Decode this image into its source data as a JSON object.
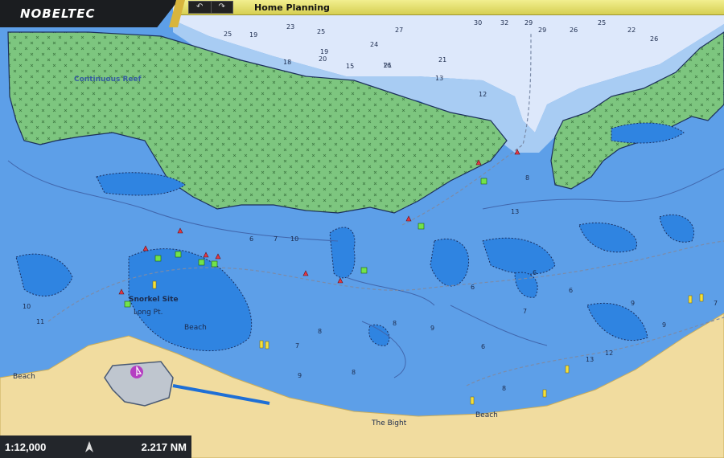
{
  "app": {
    "brand": "NOBELTEC",
    "brand_mark": "®",
    "title": "Home Planning"
  },
  "toolbar": {
    "back_icon": "undo-icon",
    "forward_icon": "redo-icon"
  },
  "colors": {
    "land": "#f1dc9f",
    "reef": "#7dc67f",
    "shallow": "#2f84e1",
    "mid": "#5d9fe8",
    "deep": "#a8ccf3",
    "deepest": "#dde8fb",
    "accent": "#d8b53d"
  },
  "status": {
    "scale": "1:12,000",
    "distance": "2.217 NM"
  },
  "labels": {
    "continuous_reef": "Continuous Reef",
    "snorkel_site": "Snorkel Site",
    "long_pt": "Long Pt.",
    "beach_1": "Beach",
    "beach_2": "Beach",
    "beach_3": "Beach",
    "the_bight": "The Bight"
  },
  "soundings": [
    [
      "25",
      "19",
      "23",
      "18",
      "19",
      "15",
      "16",
      "13"
    ],
    [
      "27",
      "21",
      "20",
      "26",
      "25",
      "24",
      "21",
      "12"
    ],
    [
      "30",
      "32",
      "29",
      "29",
      "26",
      "25",
      "22",
      "26"
    ],
    [
      "10",
      "11",
      "9",
      "8",
      "6",
      "7",
      "6",
      "8",
      "8",
      "13",
      "12",
      "13"
    ],
    [
      "10",
      "7",
      "8",
      "8",
      "9",
      "6",
      "7",
      "6",
      "6",
      "9",
      "9",
      "7"
    ]
  ]
}
